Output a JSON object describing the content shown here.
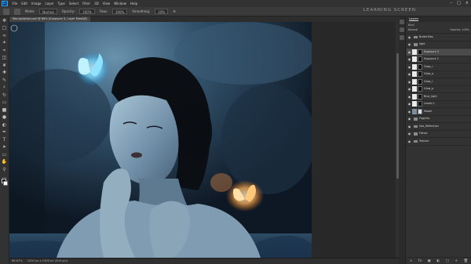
{
  "app": {
    "logo": "Ps"
  },
  "menu": [
    "File",
    "Edit",
    "Image",
    "Layer",
    "Type",
    "Select",
    "Filter",
    "3D",
    "View",
    "Window",
    "Help"
  ],
  "options": {
    "mode_label": "Mode:",
    "mode_value": "Normal",
    "opacity_label": "Opacity:",
    "opacity_value": "100%",
    "flow_label": "Flow:",
    "flow_value": "100%",
    "smoothing_label": "Smoothing:",
    "smoothing_value": "10%"
  },
  "watermark": "LEARNING SCREEN",
  "document": {
    "tab_title": "Manipulation.psd @ 66% (Exposure 3, Layer Mask/8)"
  },
  "status": {
    "zoom": "66.67%",
    "doc_size": "2200 px x 1300 px (300 ppi)"
  },
  "layers_panel": {
    "tab": "Layers",
    "kind_label": "Kind",
    "blend_mode": "Normal",
    "opacity": "Opacity: 100%",
    "lock_label": "Lock:",
    "fill": "Fill: 100%",
    "layers": [
      {
        "name": "Butterflies",
        "type": "group"
      },
      {
        "name": "light",
        "type": "group"
      },
      {
        "name": "Exposure 3",
        "type": "adjustment",
        "selected": true
      },
      {
        "name": "Exposure 2",
        "type": "adjustment"
      },
      {
        "name": "Glow_r",
        "type": "adjustment"
      },
      {
        "name": "Glow_a",
        "type": "adjustment"
      },
      {
        "name": "Glow_r",
        "type": "adjustment"
      },
      {
        "name": "Glow_p",
        "type": "adjustment"
      },
      {
        "name": "Blue_light",
        "type": "adjustment"
      },
      {
        "name": "Levels 1",
        "type": "adjustment"
      },
      {
        "name": "Model",
        "type": "pixel"
      },
      {
        "name": "Fog/city",
        "type": "group"
      },
      {
        "name": "Sea_Reflection",
        "type": "group"
      },
      {
        "name": "Fishes",
        "type": "group"
      },
      {
        "name": "Texture",
        "type": "group"
      }
    ]
  }
}
